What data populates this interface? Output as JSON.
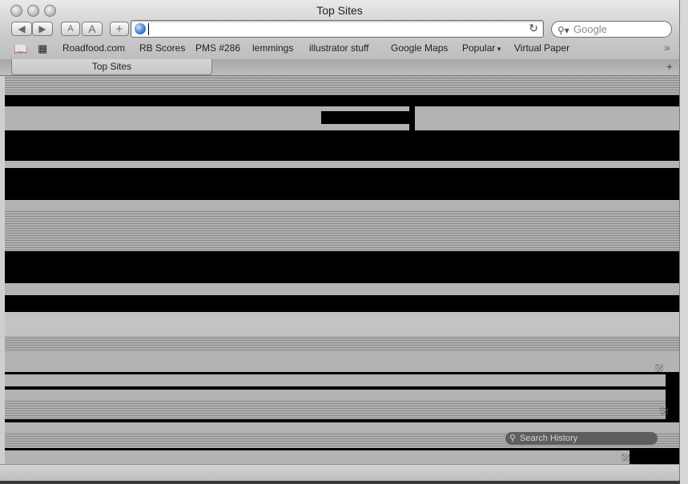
{
  "window": {
    "title": "Top Sites"
  },
  "toolbar": {
    "back_icon": "◀",
    "forward_icon": "▶",
    "smaller_text_label": "A",
    "larger_text_label": "A",
    "add_bookmark_label": "+",
    "reload_icon": "↻"
  },
  "url_bar": {
    "value": ""
  },
  "search": {
    "placeholder": "Google",
    "icon": "search-icon"
  },
  "bookmarks": {
    "items": [
      "Roadfood.com",
      "RB Scores",
      "PMS #286",
      "lemmings",
      "illustrator stuff",
      "Google Maps",
      "Popular",
      "Virtual Paper"
    ],
    "overflow": "»"
  },
  "tabs": {
    "active": "Top Sites",
    "new_tab": "+"
  },
  "history": {
    "search_placeholder": "Search History"
  }
}
